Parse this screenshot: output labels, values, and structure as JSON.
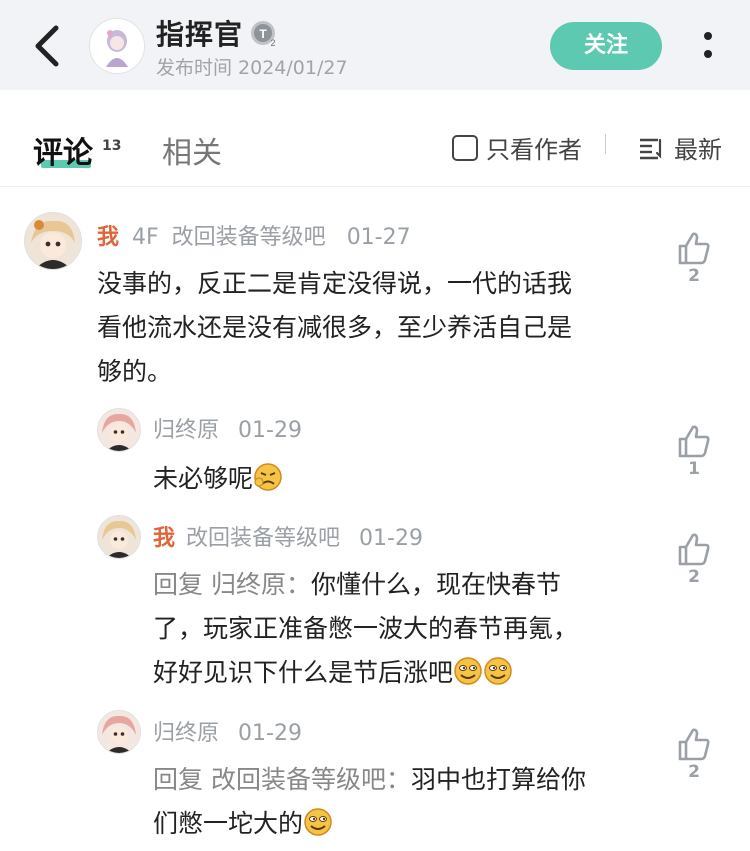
{
  "header": {
    "author_name": "指挥官",
    "publish_time": "发布时间 2024/01/27",
    "follow_label": "关注",
    "icons": [
      "back-arrow-icon",
      "level-badge-icon",
      "more-vertical-icon"
    ],
    "colors": {
      "accent": "#5dc9b0",
      "background": "#f1f3f6"
    }
  },
  "tabs": {
    "comments_label": "评论",
    "comments_count": "13",
    "related_label": "相关",
    "author_only_label": "只看作者",
    "sort_label": "最新"
  },
  "comments": [
    {
      "author": "我",
      "floor": "4F",
      "nickname": "改回装备等级吧",
      "date": "01-27",
      "line1": "没事的，反正二是肯定没得说，一代的话我",
      "line2": "看他流水还是没有减很多，至少养活自己是",
      "line3": "够的。",
      "likes": "2"
    }
  ],
  "replies": [
    {
      "author": "归终原",
      "date": "01-29",
      "text": "未必够呢",
      "emoji": "angry-emoji-icon",
      "likes": "1"
    },
    {
      "author_me": "我",
      "nickname": "改回装备等级吧",
      "date": "01-29",
      "reply_prefix": "回复 归终原：",
      "line1": "你懂什么，现在快春节",
      "line2": "了，玩家正准备憋一波大的春节再氪，",
      "line3": "好好见识下什么是节后涨吧",
      "likes": "2"
    },
    {
      "author": "归终原",
      "date": "01-29",
      "reply_prefix": "回复 改回装备等级吧：",
      "line1": "羽中也打算给你",
      "line2": "们憋一坨大的",
      "likes": "2"
    }
  ],
  "accent_me_color": "#e0653a"
}
